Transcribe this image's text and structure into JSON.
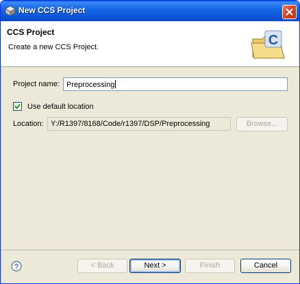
{
  "window": {
    "title": "New CCS Project",
    "icon": "eclipse-wizard-icon"
  },
  "header": {
    "title": "CCS Project",
    "description": "Create a new CCS Project.",
    "banner_icon": "ccs-folder-icon"
  },
  "form": {
    "project_name_label": "Project name:",
    "project_name_value": "Preprocessing",
    "use_default_location_label": "Use default location",
    "use_default_location_checked": true,
    "location_label": "Location:",
    "location_value": "Y:/R1397/8168/Code/r1397/DSP/Preprocessing",
    "browse_label": "Browse..."
  },
  "buttons": {
    "back": "< Back",
    "next": "Next >",
    "finish": "Finish",
    "cancel": "Cancel"
  },
  "colors": {
    "titlebar": "#0a5ae8",
    "dialog_bg": "#ece9d8",
    "close_button": "#d8492a",
    "input_border": "#7f9db9"
  }
}
